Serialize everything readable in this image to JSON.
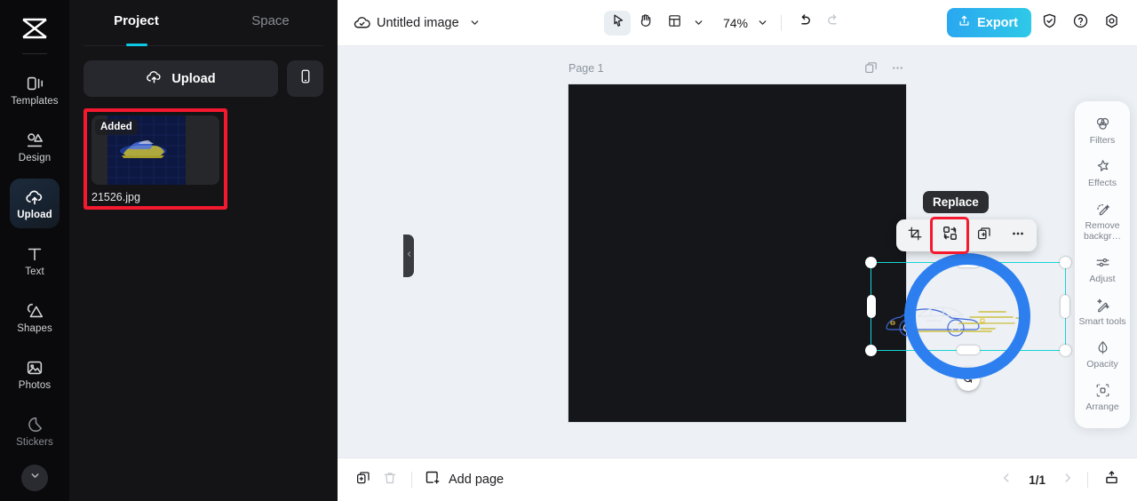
{
  "left_rail": {
    "logo_icon": "capcut-logo-icon",
    "items": [
      {
        "label": "Templates",
        "icon": "templates-icon",
        "active": false
      },
      {
        "label": "Design",
        "icon": "design-icon",
        "active": false
      },
      {
        "label": "Upload",
        "icon": "upload-cloud-icon",
        "active": true
      },
      {
        "label": "Text",
        "icon": "text-icon",
        "active": false
      },
      {
        "label": "Shapes",
        "icon": "shapes-icon",
        "active": false
      },
      {
        "label": "Photos",
        "icon": "photos-icon",
        "active": false
      },
      {
        "label": "Stickers",
        "icon": "stickers-icon",
        "active": false
      }
    ],
    "more_icon": "chevron-down-icon"
  },
  "panel": {
    "tabs": [
      {
        "label": "Project",
        "selected": true
      },
      {
        "label": "Space",
        "selected": false
      }
    ],
    "upload_label": "Upload",
    "upload_icon": "upload-cloud-icon",
    "device_icon": "mobile-device-icon",
    "asset": {
      "badge": "Added",
      "filename": "21526.jpg",
      "highlight_color": "#f5192f"
    },
    "collapse_icon": "chevron-left-icon"
  },
  "topbar": {
    "cloud_icon": "cloud-check-icon",
    "doc_title": "Untitled image",
    "title_chevron_icon": "chevron-down-icon",
    "tools": [
      {
        "name": "select-tool",
        "icon": "cursor-arrow-icon",
        "active": true
      },
      {
        "name": "hand-tool",
        "icon": "hand-icon",
        "active": false
      },
      {
        "name": "layout-tool",
        "icon": "layout-grid-icon",
        "active": false
      }
    ],
    "layout_chevron_icon": "chevron-down-icon",
    "zoom_level": "74%",
    "zoom_chevron_icon": "chevron-down-icon",
    "undo_icon": "undo-arrow-icon",
    "redo_icon": "redo-arrow-icon",
    "export_label": "Export",
    "export_icon": "share-up-icon",
    "export_color": "#2ab8ea",
    "right_icons": [
      {
        "name": "shield-check-icon"
      },
      {
        "name": "help-circle-icon"
      },
      {
        "name": "settings-gear-icon"
      }
    ]
  },
  "canvas": {
    "page_label": "Page 1",
    "page_tools": [
      {
        "name": "duplicate-page-icon"
      },
      {
        "name": "more-options-icon"
      }
    ],
    "page_background": "#15161a",
    "selection_color": "#14d5d5",
    "ring_color": "#2d7ff0",
    "object_toolbar": {
      "tooltip": "Replace",
      "buttons": [
        {
          "name": "crop-button",
          "icon": "crop-icon",
          "highlighted": false
        },
        {
          "name": "replace-button",
          "icon": "replace-image-icon",
          "highlighted": true
        },
        {
          "name": "duplicate-button",
          "icon": "duplicate-add-icon",
          "highlighted": false
        },
        {
          "name": "more-button",
          "icon": "more-horizontal-icon",
          "highlighted": false
        }
      ]
    },
    "rotate_icon": "rotate-icon"
  },
  "right_panel": {
    "items": [
      {
        "label": "Filters",
        "icon": "filters-circles-icon"
      },
      {
        "label": "Effects",
        "icon": "effects-star-icon"
      },
      {
        "label": "Remove backgr…",
        "icon": "remove-background-icon"
      },
      {
        "label": "Adjust",
        "icon": "adjust-sliders-icon"
      },
      {
        "label": "Smart tools",
        "icon": "smart-tools-wand-icon"
      },
      {
        "label": "Opacity",
        "icon": "opacity-droplet-icon"
      },
      {
        "label": "Arrange",
        "icon": "arrange-icon"
      }
    ]
  },
  "bottombar": {
    "duplicate_icon": "duplicate-page-icon",
    "delete_icon": "trash-icon",
    "add_page_label": "Add page",
    "add_page_icon": "add-page-icon",
    "prev_icon": "chevron-left-icon",
    "page_indicator": "1/1",
    "next_icon": "chevron-right-icon",
    "present_icon": "present-icon"
  }
}
